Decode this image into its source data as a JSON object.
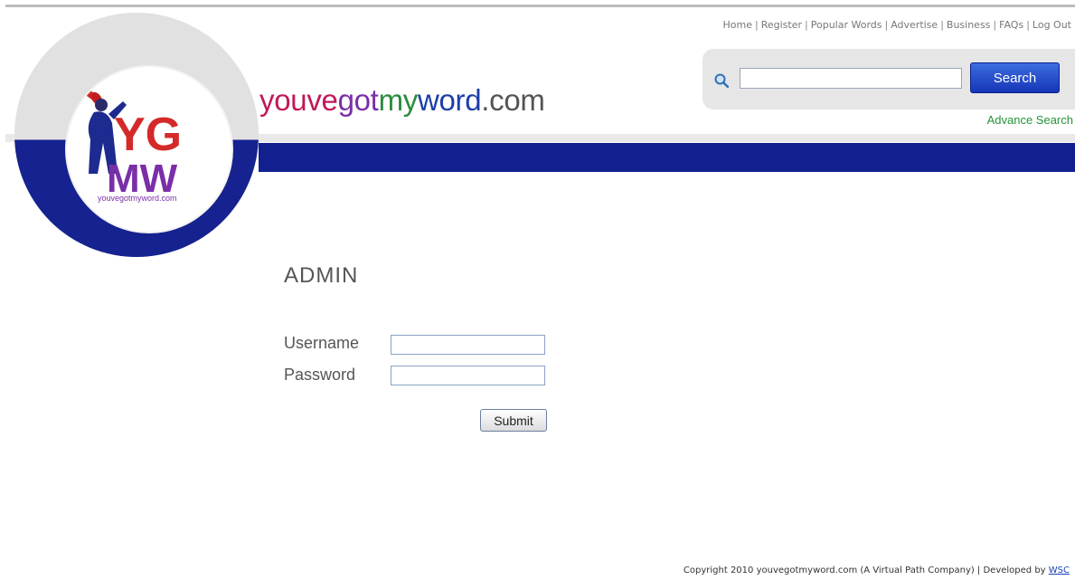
{
  "header": {
    "site_name": {
      "you": "you",
      "ve": "ve",
      "got": "got",
      "my": "my",
      "word": "word",
      "com": ".com"
    },
    "logo": {
      "letters_top": "YG",
      "letters_bottom": "MW",
      "caption": "youvegotmyword.com"
    }
  },
  "topnav": {
    "items": [
      {
        "label": "Home"
      },
      {
        "label": "Register"
      },
      {
        "label": "Popular Words"
      },
      {
        "label": "Advertise"
      },
      {
        "label": "Business"
      },
      {
        "label": "FAQs"
      },
      {
        "label": "Log Out"
      }
    ],
    "separator": "|"
  },
  "search": {
    "icon": "search-icon",
    "input_value": "",
    "button_label": "Search",
    "advance_link": "Advance Search"
  },
  "admin_form": {
    "heading": "ADMIN",
    "username_label": "Username",
    "username_value": "",
    "password_label": "Password",
    "password_value": "",
    "submit_label": "Submit"
  },
  "footer": {
    "copyright": "Copyright 2010 youvegotmyword.com (A Virtual Path Company) | Developed by ",
    "developer_link": "WSC"
  },
  "colors": {
    "brand_blue": "#12208f",
    "accent_green": "#239438",
    "logo_red": "#d42a2a",
    "logo_green": "#2c9a3e",
    "logo_purple": "#7a2fa8"
  }
}
